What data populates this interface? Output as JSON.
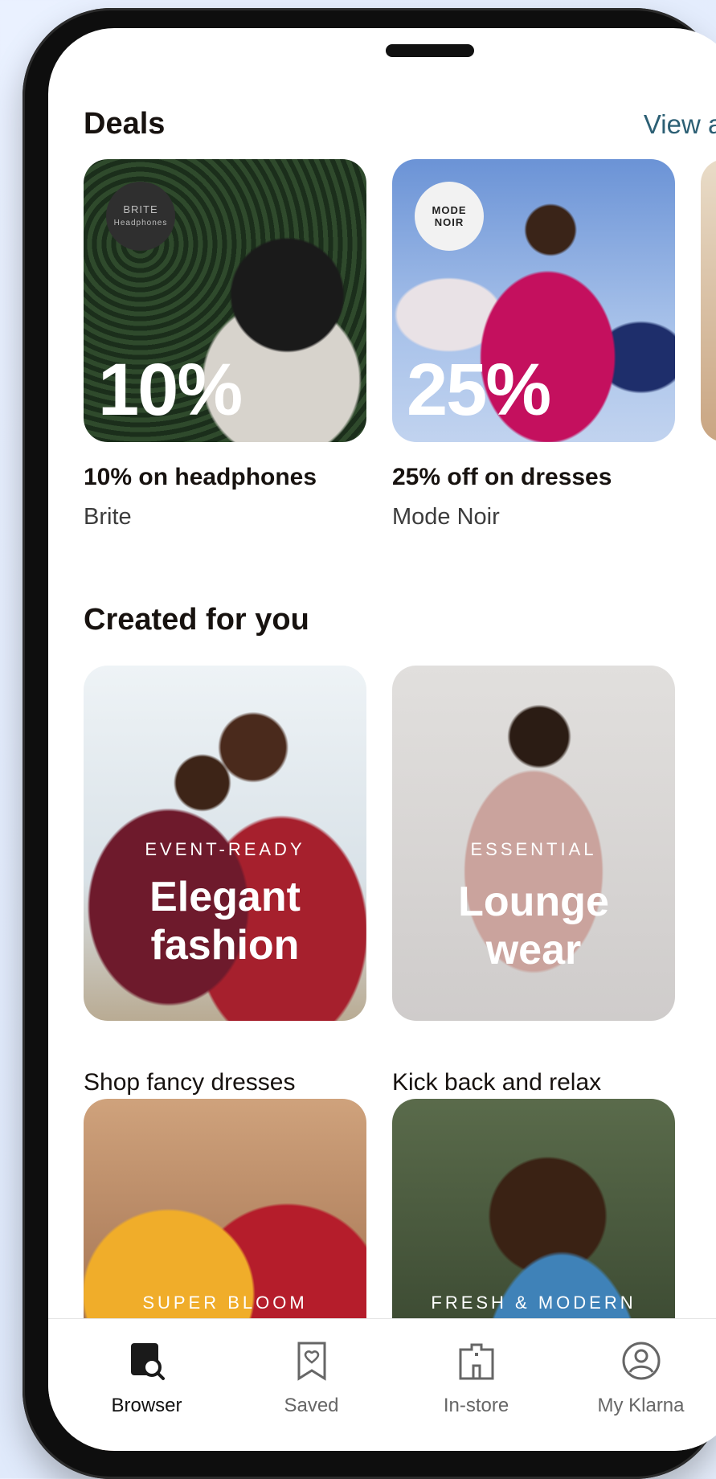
{
  "deals": {
    "title": "Deals",
    "view_all": "View all",
    "items": [
      {
        "badge": "BRITE",
        "badge_sub": "Headphones",
        "percent": "10%",
        "title": "10% on headphones",
        "merchant": "Brite"
      },
      {
        "badge": "MODE",
        "badge_sub": "NOIR",
        "percent": "25%",
        "title": "25% off on dresses",
        "merchant": "Mode Noir"
      }
    ]
  },
  "created": {
    "title": "Created for you",
    "cards": [
      {
        "tag": "EVENT-READY",
        "headline1": "Elegant",
        "headline2": "fashion",
        "caption": "Shop fancy dresses"
      },
      {
        "tag": "ESSENTIAL",
        "headline1": "Lounge",
        "headline2": "wear",
        "caption": "Kick back and relax"
      },
      {
        "tag": "SUPER BLOOM"
      },
      {
        "tag": "FRESH & MODERN"
      }
    ]
  },
  "nav": {
    "items": [
      {
        "label": "Browser",
        "icon": "browser-search-icon",
        "active": true
      },
      {
        "label": "Saved",
        "icon": "saved-heart-icon",
        "active": false
      },
      {
        "label": "In-store",
        "icon": "store-icon",
        "active": false
      },
      {
        "label": "My Klarna",
        "icon": "profile-icon",
        "active": false
      }
    ]
  },
  "colors": {
    "accent_link": "#2c5f74",
    "text": "#17120f"
  }
}
